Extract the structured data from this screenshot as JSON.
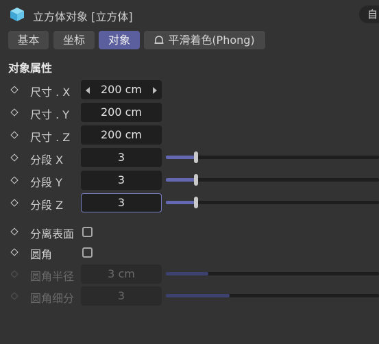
{
  "header": {
    "icon": "cube-icon",
    "title": "立方体对象 [立方体]",
    "corner_button": "自"
  },
  "tabs": [
    {
      "label": "基本",
      "active": false
    },
    {
      "label": "坐标",
      "active": false
    },
    {
      "label": "对象",
      "active": true
    },
    {
      "label": "平滑着色(Phong)",
      "active": false,
      "icon": "bell-icon"
    }
  ],
  "section_title": "对象属性",
  "properties": {
    "size_x": {
      "label": "尺寸 . X",
      "value": "200 cm"
    },
    "size_y": {
      "label": "尺寸 . Y",
      "value": "200 cm"
    },
    "size_z": {
      "label": "尺寸 . Z",
      "value": "200 cm"
    },
    "seg_x": {
      "label": "分段 X",
      "value": "3",
      "slider_fraction": 0.14
    },
    "seg_y": {
      "label": "分段 Y",
      "value": "3",
      "slider_fraction": 0.14
    },
    "seg_z": {
      "label": "分段 Z",
      "value": "3",
      "slider_fraction": 0.14
    },
    "separate_surfaces": {
      "label": "分离表面",
      "checked": false
    },
    "fillet": {
      "label": "圆角",
      "checked": false
    },
    "fillet_radius": {
      "label": "圆角半径",
      "value": "3 cm",
      "slider_fraction": 0.2,
      "disabled": true
    },
    "fillet_subdiv": {
      "label": "圆角细分",
      "value": "3",
      "slider_fraction": 0.3,
      "disabled": true
    }
  },
  "colors": {
    "accent": "#5c5f9e",
    "slider_fill": "#6368b0",
    "background": "#333333"
  }
}
